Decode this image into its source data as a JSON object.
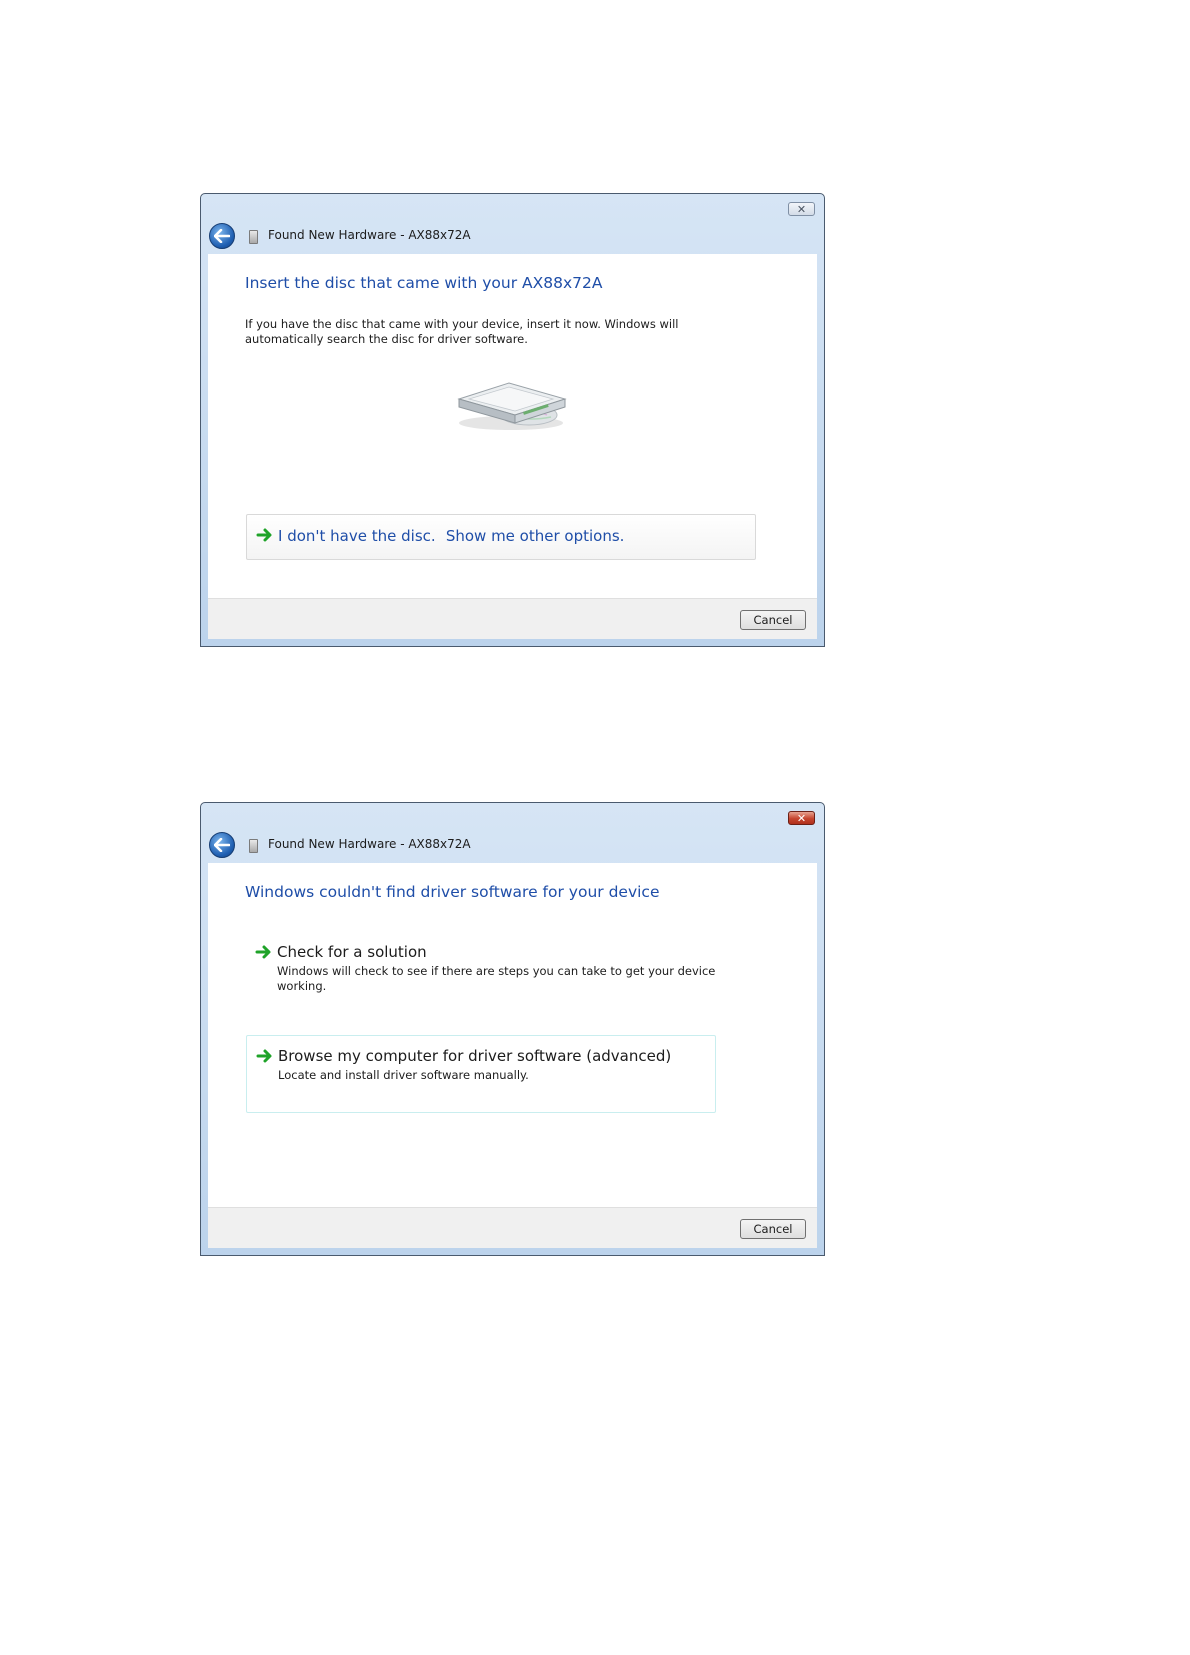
{
  "dialog1": {
    "title": "Found New Hardware - AX88x72A",
    "close_icon": "close-icon",
    "heading": "Insert the disc that came with your AX88x72A",
    "description": "If you have the disc that came with your device, insert it now.  Windows will automatically search the disc for driver software.",
    "disc_image": "cd-drive-icon",
    "option": {
      "icon": "green-arrow-icon",
      "part1": "I don't have the disc.",
      "part2": "Show me other options."
    },
    "cancel_label": "Cancel"
  },
  "dialog2": {
    "title": "Found New Hardware - AX88x72A",
    "close_icon": "close-icon",
    "heading": "Windows couldn't find driver software for your device",
    "options": [
      {
        "icon": "green-arrow-icon",
        "label": "Check for a solution",
        "description": "Windows will check to see if there are steps you can take to get your device working."
      },
      {
        "icon": "green-arrow-icon",
        "label": "Browse my computer for driver software (advanced)",
        "description": "Locate and install driver software manually."
      }
    ],
    "cancel_label": "Cancel"
  },
  "colors": {
    "link_blue": "#1f4ea8",
    "arrow_green": "#1fa329",
    "close_red": "#c6452f"
  }
}
